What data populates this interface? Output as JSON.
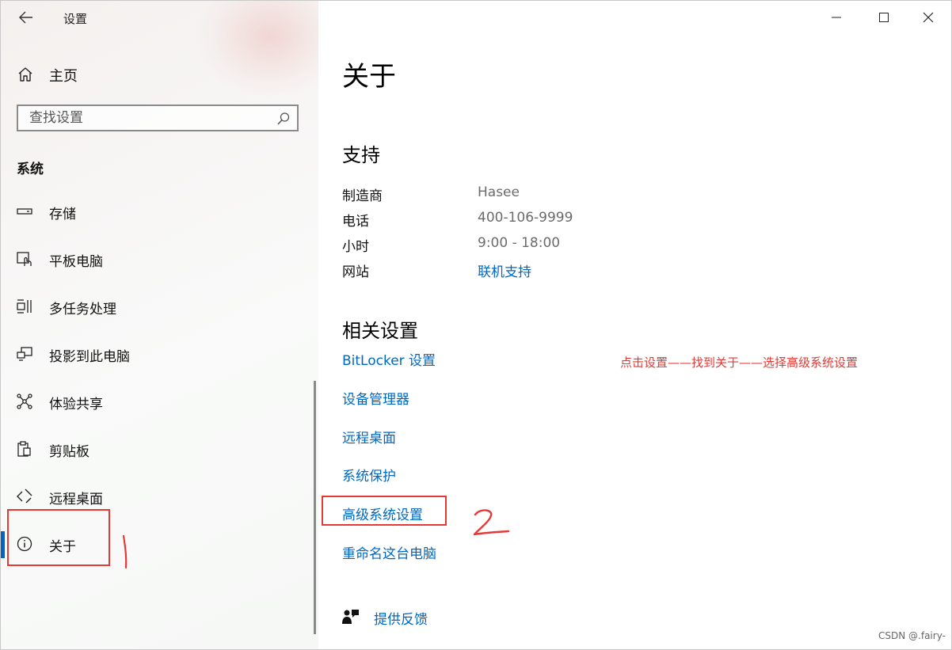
{
  "window": {
    "app_title": "设置",
    "back_icon": "back-arrow-icon",
    "controls": [
      "minimize-icon",
      "maximize-icon",
      "close-icon"
    ]
  },
  "sidebar": {
    "home_label": "主页",
    "search_placeholder": "查找设置",
    "section_title": "系统",
    "items": [
      {
        "label": "存储",
        "icon": "storage-icon"
      },
      {
        "label": "平板电脑",
        "icon": "tablet-icon"
      },
      {
        "label": "多任务处理",
        "icon": "multitasking-icon"
      },
      {
        "label": "投影到此电脑",
        "icon": "project-icon"
      },
      {
        "label": "体验共享",
        "icon": "share-icon"
      },
      {
        "label": "剪贴板",
        "icon": "clipboard-icon"
      },
      {
        "label": "远程桌面",
        "icon": "remote-desktop-icon"
      },
      {
        "label": "关于",
        "icon": "info-icon",
        "active": true
      }
    ],
    "annotation_number": "1"
  },
  "main": {
    "page_title": "关于",
    "support": {
      "heading": "支持",
      "rows": [
        {
          "key": "制造商",
          "value": "Hasee"
        },
        {
          "key": "电话",
          "value": "400-106-9999"
        },
        {
          "key": "小时",
          "value": "9:00 - 18:00"
        },
        {
          "key": "网站",
          "value": "联机支持"
        }
      ]
    },
    "related": {
      "heading": "相关设置",
      "links": [
        "BitLocker 设置",
        "设备管理器",
        "远程桌面",
        "系统保护",
        "高级系统设置",
        "重命名这台电脑"
      ]
    },
    "annotation_text": "点击设置——找到关于——选择高级系统设置",
    "annotation_number": "2",
    "feedback_label": "提供反馈"
  },
  "watermark": "CSDN @.fairy-",
  "colors": {
    "accent": "#0067c0",
    "annotation_red": "#e53935"
  }
}
